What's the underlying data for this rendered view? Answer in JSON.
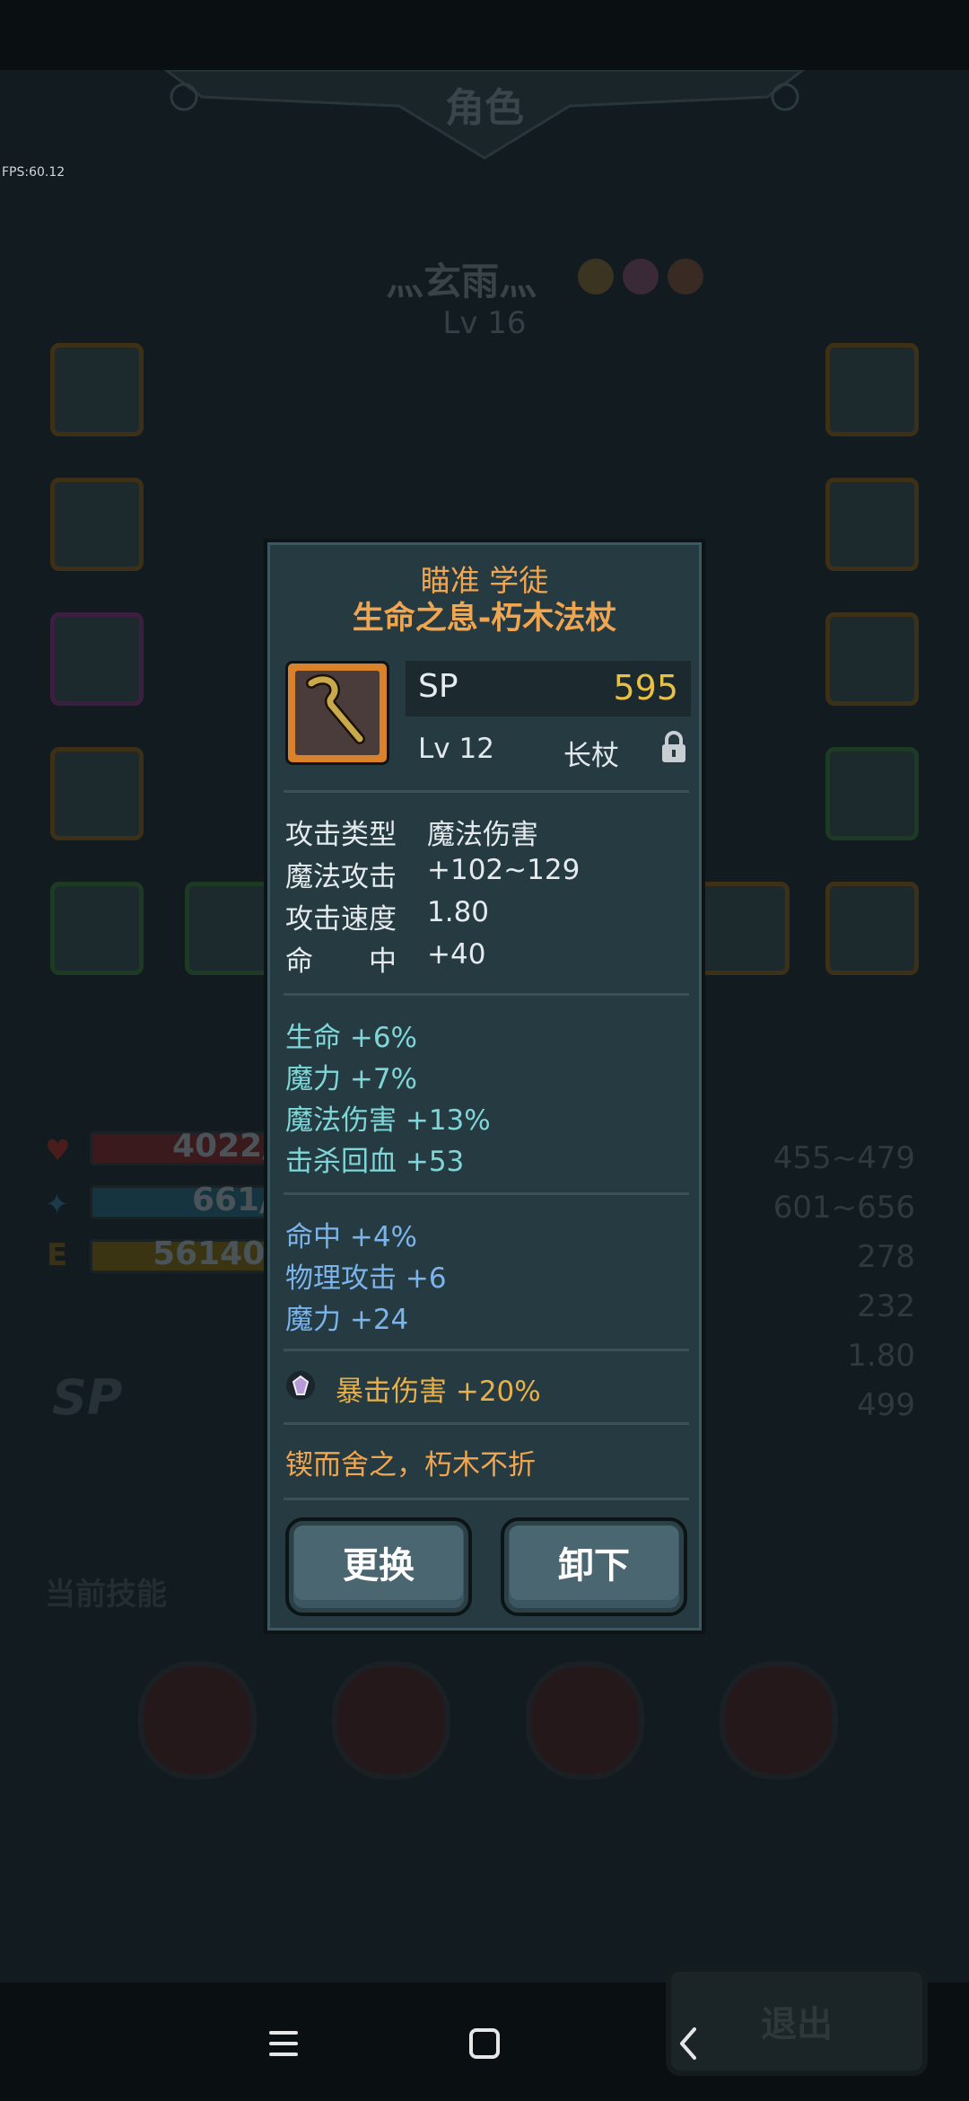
{
  "app": {
    "title": "角色",
    "fps": "FPS:60.12"
  },
  "character": {
    "name": "灬玄雨灬",
    "level": "Lv 16"
  },
  "background_stats": {
    "hp": "4022/",
    "mp": "661/",
    "exp": "56140/",
    "exp_letter": "E",
    "right_values": [
      "455~479",
      "601~656",
      "278",
      "232",
      "1.80",
      "499"
    ],
    "sp_label": "SP",
    "current_skills_label": "当前技能",
    "exit_label": "退出"
  },
  "item_popup": {
    "prefix": "瞄准 学徒",
    "name": "生命之息-朽木法杖",
    "sp_label": "SP",
    "sp_value": "595",
    "level": "Lv 12",
    "type": "长杖",
    "base_stats": [
      {
        "label": "攻击类型",
        "value": "魔法伤害"
      },
      {
        "label": "魔法攻击",
        "value": "+102~129"
      },
      {
        "label": "攻击速度",
        "value": "1.80"
      },
      {
        "label": "命　　中",
        "value": "+40"
      }
    ],
    "bonus_stats_cyan": [
      "生命 +6%",
      "魔力 +7%",
      "魔法伤害 +13%",
      "击杀回血 +53"
    ],
    "bonus_stats_blue": [
      "命中 +4%",
      "物理攻击 +6",
      "魔力 +24"
    ],
    "gem_stat": "暴击伤害 +20%",
    "flavor": "锲而舍之，朽木不折",
    "replace_label": "更换",
    "unequip_label": "卸下"
  },
  "colors": {
    "item_title": "#f0a650",
    "sp_value": "#e8c043",
    "bonus_cyan": "#7fd6d9",
    "bonus_blue": "#7ab4ea",
    "gem_text": "#e8b04a"
  },
  "nav": {
    "icons": [
      "menu-icon",
      "home-icon",
      "back-icon"
    ]
  }
}
